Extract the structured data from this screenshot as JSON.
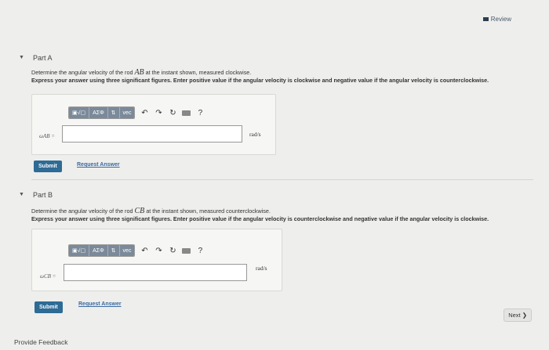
{
  "header": {
    "review_label": "Review"
  },
  "partA": {
    "label": "Part A",
    "question_prefix": "Determine the angular velocity of the rod ",
    "rod": "AB",
    "question_suffix": " at the instant shown, measured clockwise.",
    "instructions": "Express your answer using three significant figures. Enter positive value if the angular velocity is clockwise and negative value if the angular velocity is counterclockwise.",
    "variable": "ωAB =",
    "unit": "rad/s",
    "submit": "Submit",
    "request": "Request Answer"
  },
  "partB": {
    "label": "Part B",
    "question_prefix": "Determine the angular velocity of the rod ",
    "rod": "CB",
    "question_suffix": " at the instant shown, measured counterclockwise.",
    "instructions": "Express your answer using three significant figures. Enter positive value if the angular velocity is counterclockwise and negative value if the angular velocity is clockwise.",
    "variable": "ωCB =",
    "unit": "rad/s",
    "submit": "Submit",
    "request": "Request Answer"
  },
  "toolbar": {
    "templates": "▣√▢",
    "greek": "ΑΣΦ",
    "arrows": "⇅",
    "vec": "vec",
    "help": "?"
  },
  "footer": {
    "feedback": "Provide Feedback",
    "next": "Next ❯"
  }
}
